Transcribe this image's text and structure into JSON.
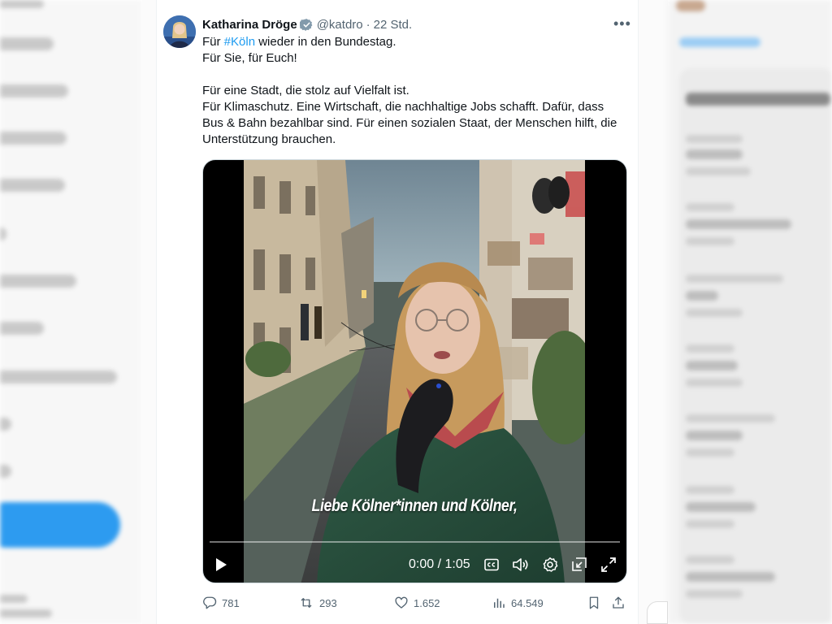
{
  "tweet": {
    "author_name": "Katharina Dröge",
    "handle": "@katdro",
    "separator": "·",
    "timestamp": "22 Std.",
    "more_label": "•••",
    "text_line1_prefix": "Für ",
    "text_hashtag": "#Köln",
    "text_line1_suffix": " wieder in den Bundestag.",
    "text_line2": "Für Sie, für Euch!",
    "text_para2_line1": "Für eine Stadt, die stolz auf Vielfalt ist.",
    "text_para2_line2": "Für Klimaschutz. Eine Wirtschaft, die nachhaltige Jobs schafft. Dafür, dass Bus & Bahn bezahlbar sind. Für einen sozialen Staat, der Menschen hilft, die Unterstützung brauchen."
  },
  "video": {
    "subtitle": "Liebe Kölner*innen und Kölner,",
    "time_current": "0:00",
    "time_separator": " / ",
    "time_total": "1:05",
    "progress_fraction": 0.0
  },
  "actions": {
    "replies": "781",
    "reposts": "293",
    "likes": "1.652",
    "views": "64.549"
  },
  "colors": {
    "accent": "#1d9bf0",
    "secondary_text": "#536471",
    "primary_text": "#0f1419"
  },
  "icons": [
    "verified-badge-icon",
    "more-icon",
    "play-icon",
    "captions-icon",
    "volume-icon",
    "settings-icon",
    "pip-icon",
    "fullscreen-icon",
    "reply-icon",
    "repost-icon",
    "like-icon",
    "views-icon",
    "bookmark-icon",
    "share-icon"
  ]
}
